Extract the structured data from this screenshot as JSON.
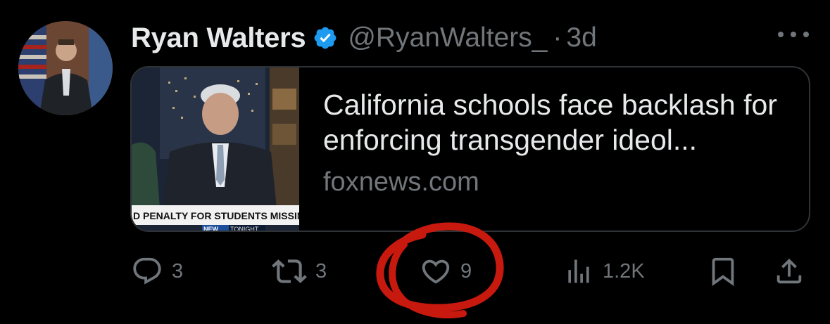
{
  "tweet": {
    "display_name": "Ryan Walters",
    "handle": "@RyanWalters_",
    "separator": "·",
    "time": "3d",
    "verified": true,
    "verified_color": "#1d9bf0"
  },
  "card": {
    "title": "California schools face backlash for enforcing transgender ideol...",
    "domain": "foxnews.com",
    "thumbnail": {
      "ticker_text": "D PENALTY FOR STUDENTS MISSING TRA",
      "network_badge": "NEW",
      "network_badge_2": "TONIGHT"
    }
  },
  "actions": {
    "reply_count": "3",
    "repost_count": "3",
    "like_count": "9",
    "views_count": "1.2K"
  },
  "icons": {
    "reply": "reply-icon",
    "repost": "repost-icon",
    "like": "heart-icon",
    "views": "views-icon",
    "bookmark": "bookmark-icon",
    "share": "share-icon",
    "more": "more-icon"
  },
  "colors": {
    "background": "#000000",
    "primary_text": "#e7e9ea",
    "secondary_text": "#71767b",
    "border": "#2f3336",
    "annotation": "#c8190f"
  }
}
